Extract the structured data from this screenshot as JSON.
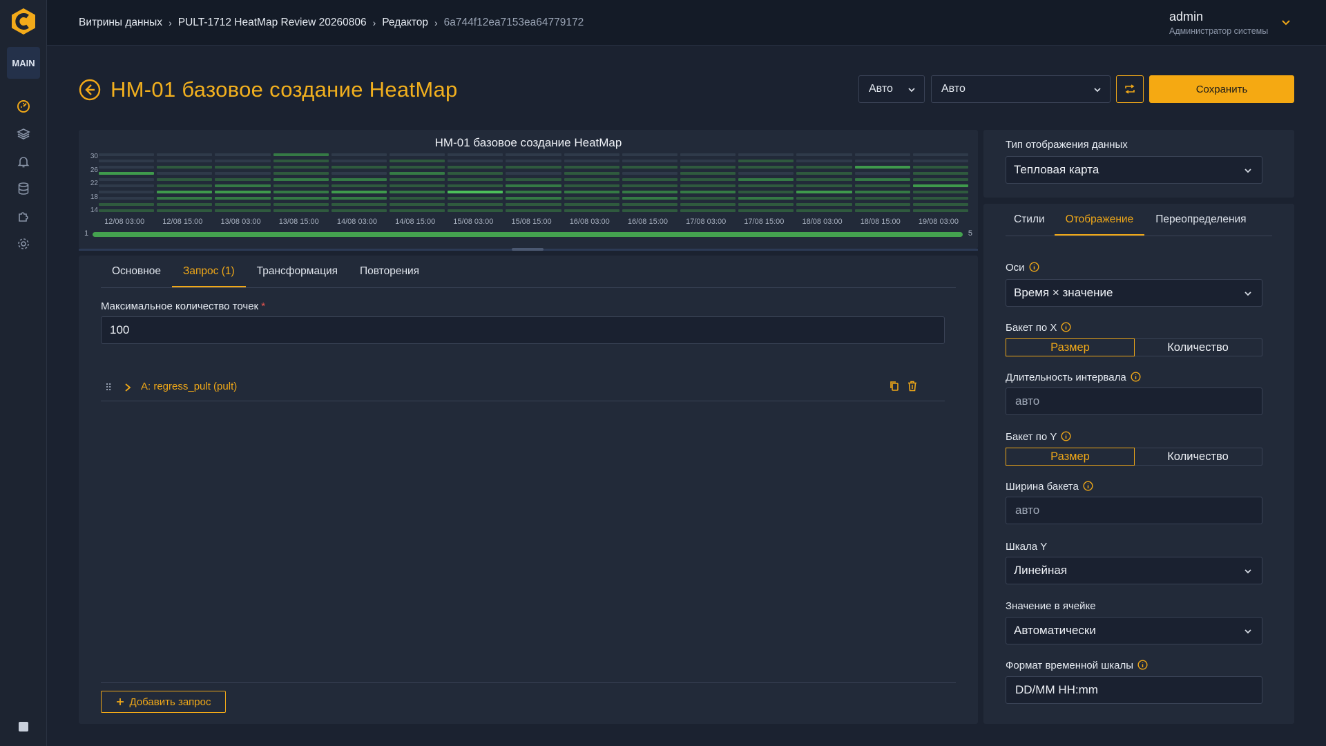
{
  "sidebar": {
    "logo": "logo-icon",
    "badge": "MAIN",
    "items": [
      {
        "icon": "dashboard-icon",
        "active": true
      },
      {
        "icon": "layers-icon",
        "active": false
      },
      {
        "icon": "bell-icon",
        "active": false
      },
      {
        "icon": "database-icon",
        "active": false
      },
      {
        "icon": "plugin-icon",
        "active": false
      },
      {
        "icon": "gear-icon",
        "active": false
      }
    ]
  },
  "breadcrumb": {
    "items": [
      "Витрины данных",
      "PULT-1712 HeatMap Review 20260806",
      "Редактор",
      "6a744f12ea7153ea64779172"
    ]
  },
  "user": {
    "name": "admin",
    "role": "Администратор системы"
  },
  "page": {
    "title": "HM-01 базовое создание HeatMap"
  },
  "toolbar": {
    "interval_select": "Авто",
    "refresh_select": "Авто",
    "save_label": "Сохранить"
  },
  "chart_data": {
    "type": "heatmap",
    "title": "HM-01 базовое создание HeatMap",
    "y_ticks": [
      "30",
      "26",
      "22",
      "18",
      "14"
    ],
    "x_ticks": [
      "12/08 03:00",
      "12/08 15:00",
      "13/08 03:00",
      "13/08 15:00",
      "14/08 03:00",
      "14/08 15:00",
      "15/08 03:00",
      "15/08 15:00",
      "16/08 03:00",
      "16/08 15:00",
      "17/08 03:00",
      "17/08 15:00",
      "18/08 03:00",
      "18/08 15:00",
      "19/08 03:00"
    ],
    "rows": 10,
    "grid": [
      [
        0,
        0,
        0,
        2,
        0,
        0,
        0,
        0,
        0,
        0,
        0,
        0,
        0,
        0,
        0
      ],
      [
        0,
        0,
        0,
        1,
        0,
        1,
        0,
        0,
        0,
        0,
        0,
        1,
        0,
        0,
        0
      ],
      [
        0,
        1,
        1,
        1,
        1,
        1,
        1,
        1,
        1,
        1,
        1,
        1,
        1,
        3,
        1
      ],
      [
        3,
        0,
        0,
        1,
        0,
        2,
        1,
        0,
        1,
        0,
        1,
        0,
        1,
        0,
        1
      ],
      [
        0,
        1,
        1,
        2,
        2,
        1,
        1,
        1,
        1,
        1,
        1,
        2,
        1,
        2,
        1
      ],
      [
        0,
        1,
        2,
        1,
        1,
        1,
        1,
        2,
        1,
        1,
        1,
        1,
        1,
        1,
        3
      ],
      [
        0,
        3,
        3,
        2,
        3,
        2,
        4,
        2,
        2,
        2,
        2,
        1,
        3,
        2,
        1
      ],
      [
        0,
        2,
        2,
        2,
        2,
        1,
        1,
        2,
        1,
        2,
        1,
        2,
        1,
        1,
        1
      ],
      [
        1,
        1,
        1,
        1,
        1,
        1,
        1,
        1,
        1,
        1,
        1,
        1,
        1,
        1,
        1
      ],
      [
        1,
        1,
        1,
        1,
        1,
        1,
        1,
        1,
        1,
        1,
        1,
        1,
        1,
        1,
        1
      ]
    ],
    "range_start": "1",
    "range_end": "5"
  },
  "editor": {
    "tabs": [
      "Основное",
      "Запрос (1)",
      "Трансформация",
      "Повторения"
    ],
    "active_tab": 1,
    "max_points_label": "Максимальное количество точек",
    "required_mark": "*",
    "max_points_value": "100",
    "query_name": "A: regress_pult (pult)",
    "add_query_label": "Добавить запрос"
  },
  "panel": {
    "display_type_label": "Тип отображения данных",
    "display_type_value": "Тепловая карта",
    "tabs": [
      "Стили",
      "Отображение",
      "Переопределения"
    ],
    "active_tab": 1,
    "axes_label": "Оси",
    "axes_value": "Время × значение",
    "bucket_x_label": "Бакет по X",
    "bucket_options": [
      "Размер",
      "Количество"
    ],
    "interval_label": "Длительность интервала",
    "interval_placeholder": "авто",
    "bucket_y_label": "Бакет по Y",
    "bucket_width_label": "Ширина бакета",
    "bucket_width_placeholder": "авто",
    "scale_y_label": "Шкала Y",
    "scale_y_value": "Линейная",
    "cell_value_label": "Значение в ячейке",
    "cell_value_value": "Автоматически",
    "time_format_label": "Формат временной шкалы",
    "time_format_value": "DD/MM HH:mm"
  },
  "colors": {
    "accent": "#f0a818",
    "bg": "#1b2230",
    "panel": "#222a39"
  }
}
